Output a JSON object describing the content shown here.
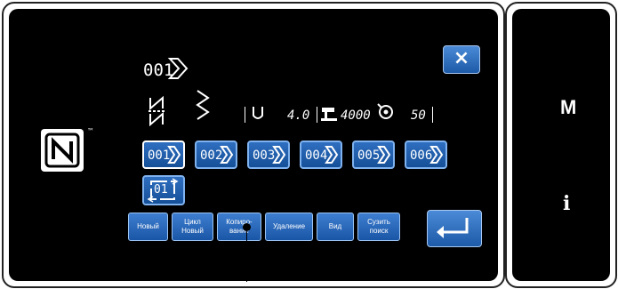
{
  "panel": {
    "nfc_mark": "N",
    "nfc_trademark": "™",
    "close_label": "×",
    "current_pattern": "001"
  },
  "params": {
    "thread_tension": "4.0",
    "speed": "4000",
    "count": "50"
  },
  "patterns": [
    {
      "label": "001",
      "selected": true
    },
    {
      "label": "002",
      "selected": false
    },
    {
      "label": "003",
      "selected": false
    },
    {
      "label": "004",
      "selected": false
    },
    {
      "label": "005",
      "selected": false
    },
    {
      "label": "006",
      "selected": false
    }
  ],
  "cycle_button": {
    "label": "01"
  },
  "actions": [
    {
      "line1": "Новый",
      "line2": ""
    },
    {
      "line1": "Цикл",
      "line2": "Новый"
    },
    {
      "line1": "Копиро-",
      "line2": "вание"
    },
    {
      "line1": "Удаление",
      "line2": ""
    },
    {
      "line1": "Вид",
      "line2": ""
    },
    {
      "line1": "Сузить",
      "line2": "поиск"
    }
  ],
  "side_panel": {
    "mode_label": "M",
    "info_label": "i"
  },
  "colors": {
    "button_blue": "#1d5aa8",
    "screen_bg": "#000000"
  }
}
